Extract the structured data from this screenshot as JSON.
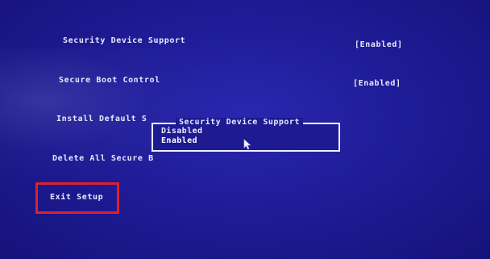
{
  "menu": {
    "items": [
      {
        "label": "Security Device Support",
        "value": "[Enabled]"
      },
      {
        "label": "Secure Boot Control",
        "value": "[Enabled]"
      },
      {
        "label": "Install Default S"
      },
      {
        "label": "Delete All Secure B"
      },
      {
        "label": "Exit Setup"
      }
    ]
  },
  "popup": {
    "title": "Security Device Support",
    "options": [
      "Disabled",
      "Enabled"
    ],
    "selected": "Enabled"
  },
  "colors": {
    "background": "#1f1c98",
    "text": "#e8e8ff",
    "highlight_border": "#e0202a"
  },
  "icons": {
    "cursor": "mouse-pointer-icon"
  }
}
